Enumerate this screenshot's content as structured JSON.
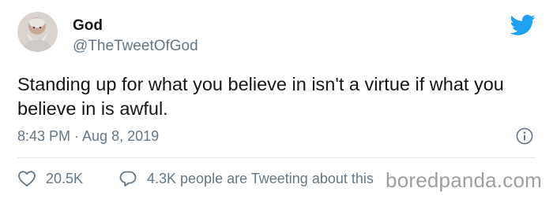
{
  "author": {
    "name": "God",
    "handle": "@TheTweetOfGod"
  },
  "tweet": {
    "text": "Standing up for what you believe in isn't a virtue if what you believe in is awful.",
    "timestamp": "8:43 PM · Aug 8, 2019"
  },
  "actions": {
    "likes": "20.5K",
    "conversation": "4.3K people are Tweeting about this"
  },
  "watermark": "boredpanda.com",
  "icons": {
    "brand": "twitter-bird-icon",
    "info": "info-icon",
    "like": "heart-icon",
    "conversation": "speech-bubble-icon"
  },
  "colors": {
    "twitter_blue": "#1da1f2",
    "secondary_text": "#657786",
    "primary_text": "#14171a"
  }
}
